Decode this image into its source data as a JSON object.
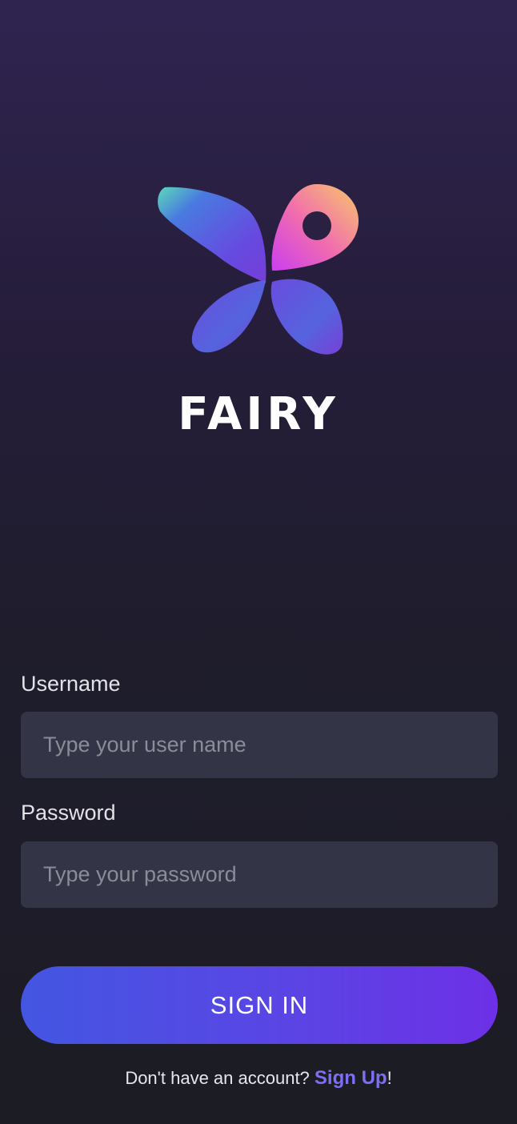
{
  "brand": {
    "name": "FAIRY",
    "logo_icon": "butterfly-location-pin-logo"
  },
  "form": {
    "username": {
      "label": "Username",
      "placeholder": "Type your user name",
      "value": ""
    },
    "password": {
      "label": "Password",
      "placeholder": "Type your password",
      "value": ""
    },
    "submit_label": "SIGN IN"
  },
  "footer": {
    "prompt": "Don't have an account? ",
    "link_label": "Sign Up",
    "suffix": "!"
  },
  "colors": {
    "accent": "#7d6ef6",
    "button_start": "#4356e2",
    "button_end": "#6d30e6",
    "input_bg": "#333446"
  }
}
